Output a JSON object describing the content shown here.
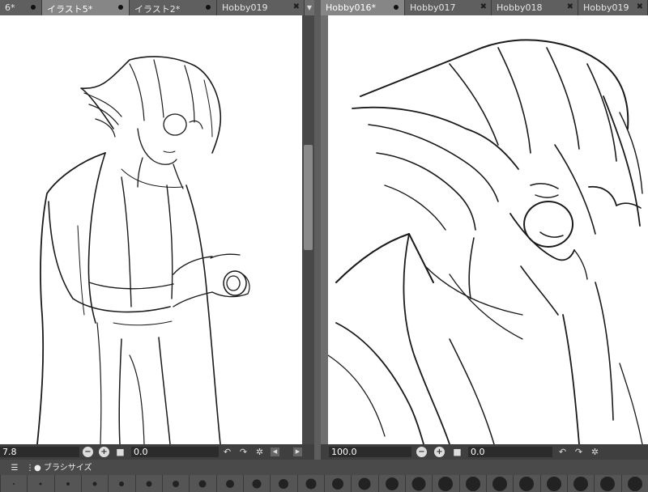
{
  "left_pane": {
    "tabs": [
      {
        "label": "6*",
        "state": "dot"
      },
      {
        "label": "イラスト5*",
        "state": "dot",
        "active": true
      },
      {
        "label": "イラスト2*",
        "state": "dot"
      },
      {
        "label": "Hobby019",
        "state": "close"
      }
    ],
    "tab_menu_icon": "chevron-down-icon",
    "status": {
      "zoom": "7.8",
      "angle": "0.0"
    }
  },
  "right_pane": {
    "tabs": [
      {
        "label": "Hobby016*",
        "state": "dot",
        "active": true
      },
      {
        "label": "Hobby017",
        "state": "close"
      },
      {
        "label": "Hobby018",
        "state": "close"
      },
      {
        "label": "Hobby019",
        "state": "close"
      }
    ],
    "status": {
      "zoom": "100.0",
      "angle": "0.0"
    }
  },
  "toolbar": {
    "tab_label": "ブラシサイズ",
    "icons": [
      "menu-icon",
      "brush-size-icon"
    ]
  },
  "icons": {
    "zoom_out": "zoom-out-icon",
    "zoom_in": "zoom-in-icon",
    "fit": "fit-screen-icon",
    "rotate_left": "rotate-left-icon",
    "rotate_right": "rotate-right-icon",
    "reset": "reset-rotation-icon",
    "scroll_left": "scroll-left-icon",
    "scroll_right": "scroll-right-icon"
  },
  "colors": {
    "paper": "#ffffff",
    "chrome": "#4e4e4e",
    "active_tab": "#868686"
  }
}
